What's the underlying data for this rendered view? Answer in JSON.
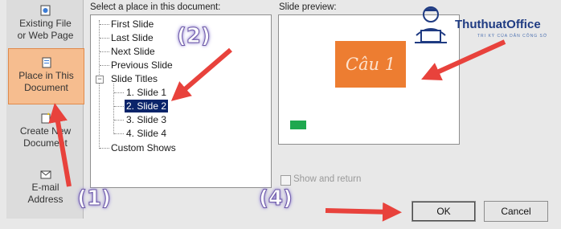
{
  "link_to": {
    "items": [
      {
        "label_1": "Existing File",
        "label_2": "or Web Page"
      },
      {
        "label_1": "Place in This",
        "label_2": "Document"
      },
      {
        "label_1": "Create New",
        "label_2": "Document"
      },
      {
        "label_1": "E-mail",
        "label_2": "Address"
      }
    ]
  },
  "tree": {
    "heading": "Select a place in this document:",
    "items": [
      "First Slide",
      "Last Slide",
      "Next Slide",
      "Previous Slide",
      "Slide Titles",
      "1. Slide 1",
      "2. Slide 2",
      "3. Slide 3",
      "4. Slide 4",
      "Custom Shows"
    ],
    "expander": "−"
  },
  "preview": {
    "heading": "Slide preview:",
    "slide_text": "Câu 1"
  },
  "options": {
    "show_and_return": "Show and return"
  },
  "buttons": {
    "ok": "OK",
    "cancel": "Cancel"
  },
  "annotations": {
    "step1": "(1)",
    "step2": "(2)",
    "step4": "(4)",
    "arrow_color": "#e8423c"
  },
  "watermark": {
    "brand": "ThuthuatOffice",
    "tagline": "TRI KỲ CỦA DÂN CÔNG SỞ"
  }
}
